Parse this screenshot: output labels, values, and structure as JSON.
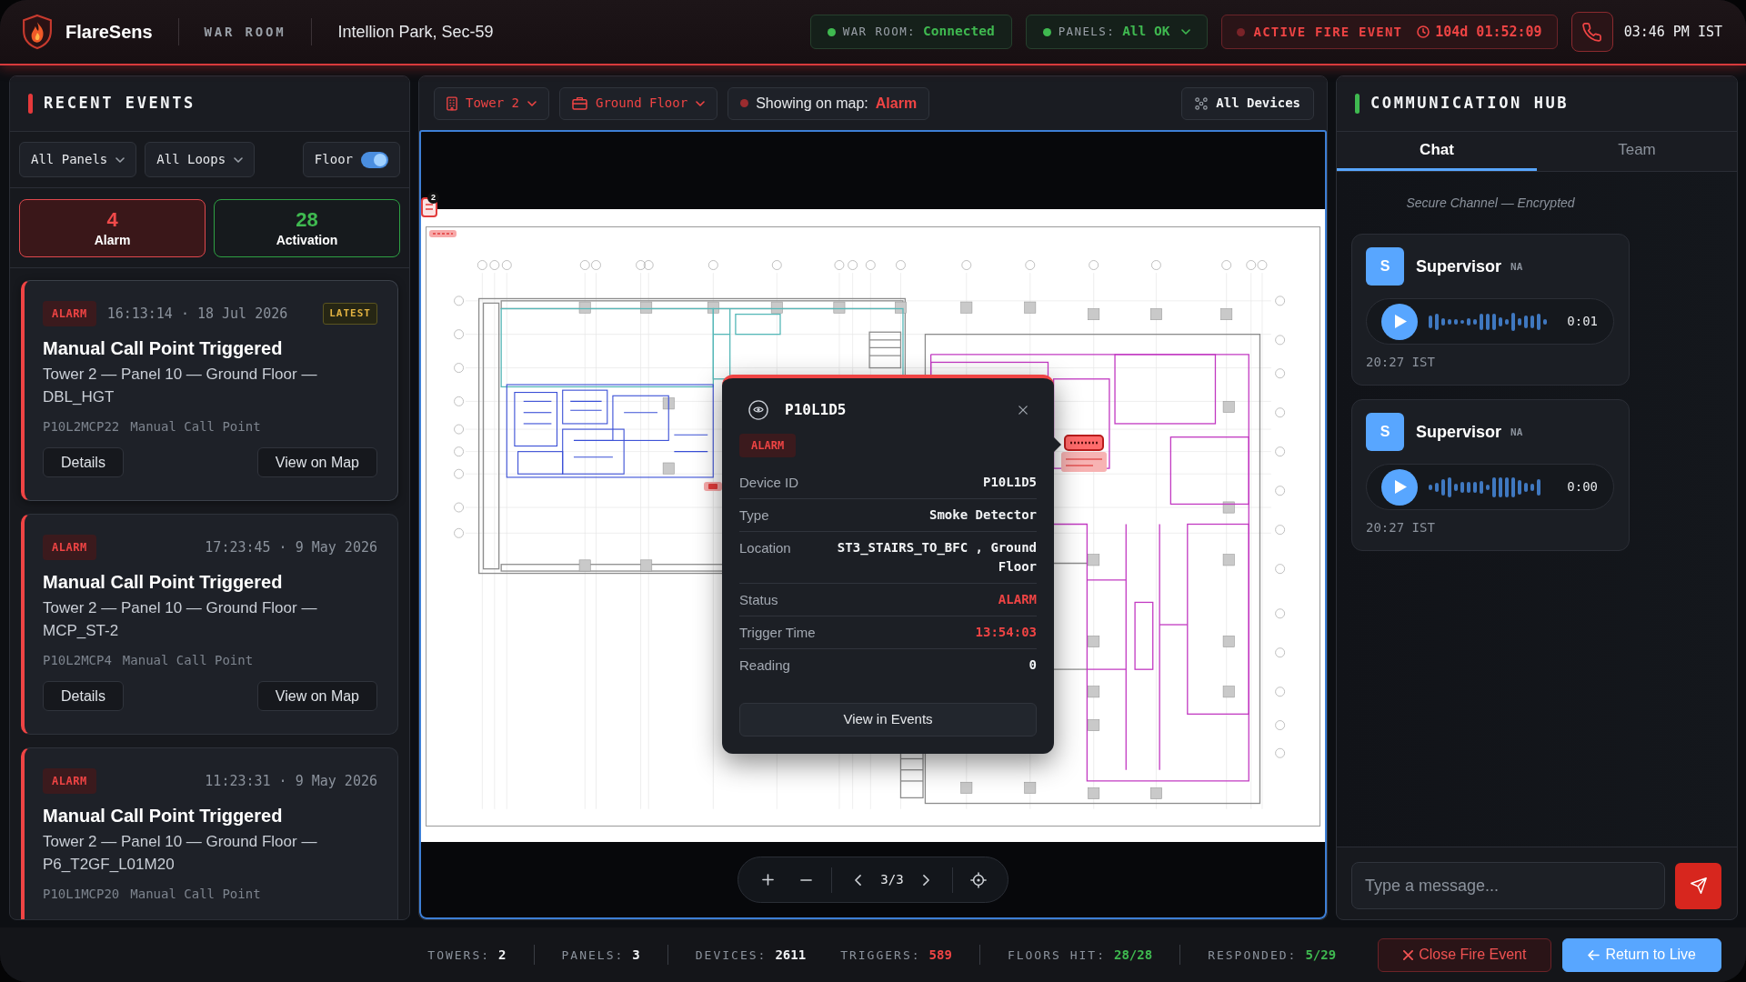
{
  "header": {
    "brand": "FlareSens",
    "mode": "WAR ROOM",
    "site": "Intellion Park, Sec-59",
    "pills": [
      {
        "kind": "ok",
        "label": "WAR ROOM:",
        "value": "Connected",
        "dropdown": false
      },
      {
        "kind": "ok",
        "label": "PANELS:",
        "value": "All OK",
        "dropdown": true
      },
      {
        "kind": "alert",
        "label": "ACTIVE FIRE EVENT",
        "value": "104d 01:52:09",
        "dropdown": false
      }
    ],
    "clock": "03:46 PM IST"
  },
  "events_panel": {
    "title": "RECENT EVENTS",
    "filters": [
      {
        "kind": "dropdown",
        "label": "All Panels"
      },
      {
        "kind": "dropdown",
        "label": "All Loops"
      },
      {
        "kind": "toggle",
        "label": "Floor",
        "on": true
      }
    ],
    "counts": [
      {
        "kind": "alarm",
        "count": "4",
        "label": "Alarm",
        "selected": true
      },
      {
        "kind": "activation",
        "count": "28",
        "label": "Activation",
        "selected": false
      }
    ],
    "events": [
      {
        "badge": "ALARM",
        "time": "16:13:14 · 18 Jul 2026",
        "tag": "LATEST",
        "title": "Manual Call Point Triggered",
        "location": "Tower 2 — Panel 10 — Ground Floor — DBL_HGT",
        "device_id": "P10L2MCP22",
        "device_type": "Manual Call Point",
        "actions": [
          "Details",
          "View on Map"
        ]
      },
      {
        "badge": "ALARM",
        "time": "17:23:45 · 9 May 2026",
        "title": "Manual Call Point Triggered",
        "location": "Tower 2 — Panel 10 — Ground Floor — MCP_ST-2",
        "device_id": "P10L2MCP4",
        "device_type": "Manual Call Point",
        "actions": [
          "Details",
          "View on Map"
        ]
      },
      {
        "badge": "ALARM",
        "time": "11:23:31 · 9 May 2026",
        "title": "Manual Call Point Triggered",
        "location": "Tower 2 — Panel 10 — Ground Floor — P6_T2GF_L01M20",
        "device_id": "P10L1MCP20",
        "device_type": "Manual Call Point"
      }
    ]
  },
  "map_panel": {
    "filters": [
      {
        "kind": "building",
        "label": "Tower 2"
      },
      {
        "kind": "floor",
        "label": "Ground Floor"
      }
    ],
    "legend": {
      "label": "Showing on map:",
      "value": "Alarm"
    },
    "all_devices": "All Devices",
    "cluster_count": "2",
    "popup": {
      "title": "P10L1D5",
      "badge": "ALARM",
      "rows": [
        {
          "label": "Device ID",
          "value": "P10L1D5",
          "alert": false
        },
        {
          "label": "Type",
          "value": "Smoke Detector",
          "alert": false
        },
        {
          "label": "Location",
          "value": "ST3_STAIRS_TO_BFC , Ground Floor",
          "alert": false
        },
        {
          "label": "Status",
          "value": "ALARM",
          "alert": true
        },
        {
          "label": "Trigger Time",
          "value": "13:54:03",
          "alert": true
        },
        {
          "label": "Reading",
          "value": "0",
          "alert": false
        }
      ],
      "action": "View in Events"
    },
    "pager": "3/3"
  },
  "comm_hub": {
    "title": "COMMUNICATION HUB",
    "tabs": [
      {
        "label": "Chat",
        "selected": true
      },
      {
        "label": "Team",
        "selected": false
      }
    ],
    "notice": "Secure Channel — Encrypted",
    "messages": [
      {
        "avatar": "S",
        "sender": "Supervisor",
        "role": "NA",
        "duration": "0:01",
        "time": "20:27 IST"
      },
      {
        "avatar": "S",
        "sender": "Supervisor",
        "role": "NA",
        "duration": "0:00",
        "time": "20:27 IST"
      }
    ],
    "composer": {
      "placeholder": "Type a message..."
    }
  },
  "footer": {
    "stat_groups": [
      [
        {
          "label": "TOWERS:",
          "value": "2",
          "kind": "plain"
        }
      ],
      [
        {
          "label": "PANELS:",
          "value": "3",
          "kind": "plain"
        }
      ],
      [
        {
          "label": "DEVICES:",
          "value": "2611",
          "kind": "plain"
        },
        {
          "label": "TRIGGERS:",
          "value": "589",
          "kind": "danger"
        }
      ],
      [
        {
          "label": "FLOORS HIT:",
          "value": "28/28",
          "kind": "success"
        }
      ],
      [
        {
          "label": "RESPONDED:",
          "value": "5/29",
          "kind": "success"
        }
      ]
    ],
    "buttons": [
      {
        "kind": "danger",
        "label": "Close Fire Event"
      },
      {
        "kind": "primary",
        "label": "Return to Live"
      }
    ]
  }
}
